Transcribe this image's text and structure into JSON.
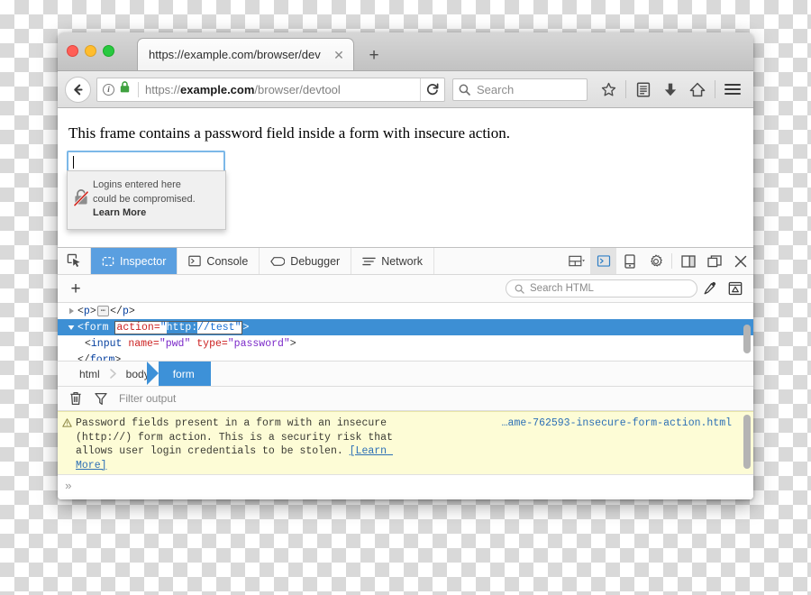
{
  "window": {
    "traffic_lights": [
      "close",
      "minimize",
      "zoom"
    ],
    "tab": {
      "title": "https://example.com/browser/dev",
      "close_label": "✕"
    },
    "new_tab_label": "+"
  },
  "navbar": {
    "back_label": "←",
    "identity_info": "i",
    "url_prefix": "https://",
    "url_domain": "example.com",
    "url_path": "/browser/devtool",
    "reload_label": "↻",
    "search_placeholder": "Search",
    "icons": [
      "star-icon",
      "reader-icon",
      "downloads-icon",
      "home-icon",
      "menu-icon"
    ]
  },
  "page": {
    "heading": "This frame contains a password field inside a form with insecure action.",
    "password_input_value": "",
    "tooltip": {
      "line1": "Logins entered here",
      "line2": "could be compromised.",
      "learn_more": "Learn More",
      "icon": "broken-lock-icon"
    }
  },
  "devtools": {
    "picker_icon": "node-picker-icon",
    "tabs": [
      {
        "label": "Inspector",
        "icon": "inspector-icon",
        "active": true
      },
      {
        "label": "Console",
        "icon": "console-icon",
        "active": false
      },
      {
        "label": "Debugger",
        "icon": "debugger-icon",
        "active": false
      },
      {
        "label": "Network",
        "icon": "network-icon",
        "active": false
      }
    ],
    "right_buttons": [
      {
        "name": "split-view-icon",
        "active": false
      },
      {
        "name": "split-console-icon",
        "active": true
      },
      {
        "name": "responsive-design-icon",
        "active": false
      },
      {
        "name": "settings-gear-icon",
        "active": false
      },
      {
        "name": "dock-side-icon",
        "active": false
      },
      {
        "name": "dock-window-icon",
        "active": false
      },
      {
        "name": "close-icon",
        "active": false
      }
    ],
    "search_row": {
      "add_node_label": "+",
      "search_placeholder": "Search HTML",
      "eyedropper_icon": "eyedropper-icon",
      "screenshot_icon": "screenshot-node-icon"
    },
    "markup": {
      "rows": [
        {
          "indent": 1,
          "twisty": "▶",
          "segments": [
            {
              "t": "punc",
              "v": "<"
            },
            {
              "t": "tag",
              "v": "p"
            },
            {
              "t": "punc",
              "v": ">"
            },
            {
              "t": "ellipsis",
              "v": "…"
            },
            {
              "t": "punc",
              "v": "</"
            },
            {
              "t": "tag",
              "v": "p"
            },
            {
              "t": "punc",
              "v": ">"
            }
          ]
        }
      ],
      "form_row": {
        "twisty": "▼",
        "open_punc": "<",
        "tag": "form",
        "attr_name": "action=",
        "attr_quote": "\"",
        "attr_value_selected": "http:",
        "attr_value_rest": "//test",
        "close_punc": ">"
      },
      "input_row": {
        "open": "<",
        "tag": "input",
        "attr1_name": "name=",
        "attr1_value": "\"pwd\"",
        "attr2_name": "type=",
        "attr2_value": "\"password\"",
        "close": ">"
      },
      "close_row": {
        "open": "</",
        "tag": "form",
        "close": ">"
      }
    },
    "breadcrumb": [
      {
        "label": "html",
        "active": false
      },
      {
        "label": "body",
        "active": false
      },
      {
        "label": "form",
        "active": true
      }
    ],
    "console": {
      "clear_icon": "trash-icon",
      "filter_icon": "funnel-icon",
      "filter_placeholder": "Filter output",
      "message": {
        "severity_icon": "warning-icon",
        "text": "Password fields present in a form with an insecure (http://) form action. This is a security risk that allows user login credentials to be stolen. ",
        "link_text": "[Learn More]",
        "source": "…ame-762593-insecure-form-action.html"
      },
      "prompt_label": "»"
    }
  },
  "colors": {
    "accent_blue": "#3d91d8",
    "tab_active_blue": "#5a9fe0",
    "warn_bg": "#fdfcd6",
    "link_blue": "#2c6fb5",
    "lock_green": "#3fa13f",
    "selection_blue": "#3d8fd4"
  }
}
